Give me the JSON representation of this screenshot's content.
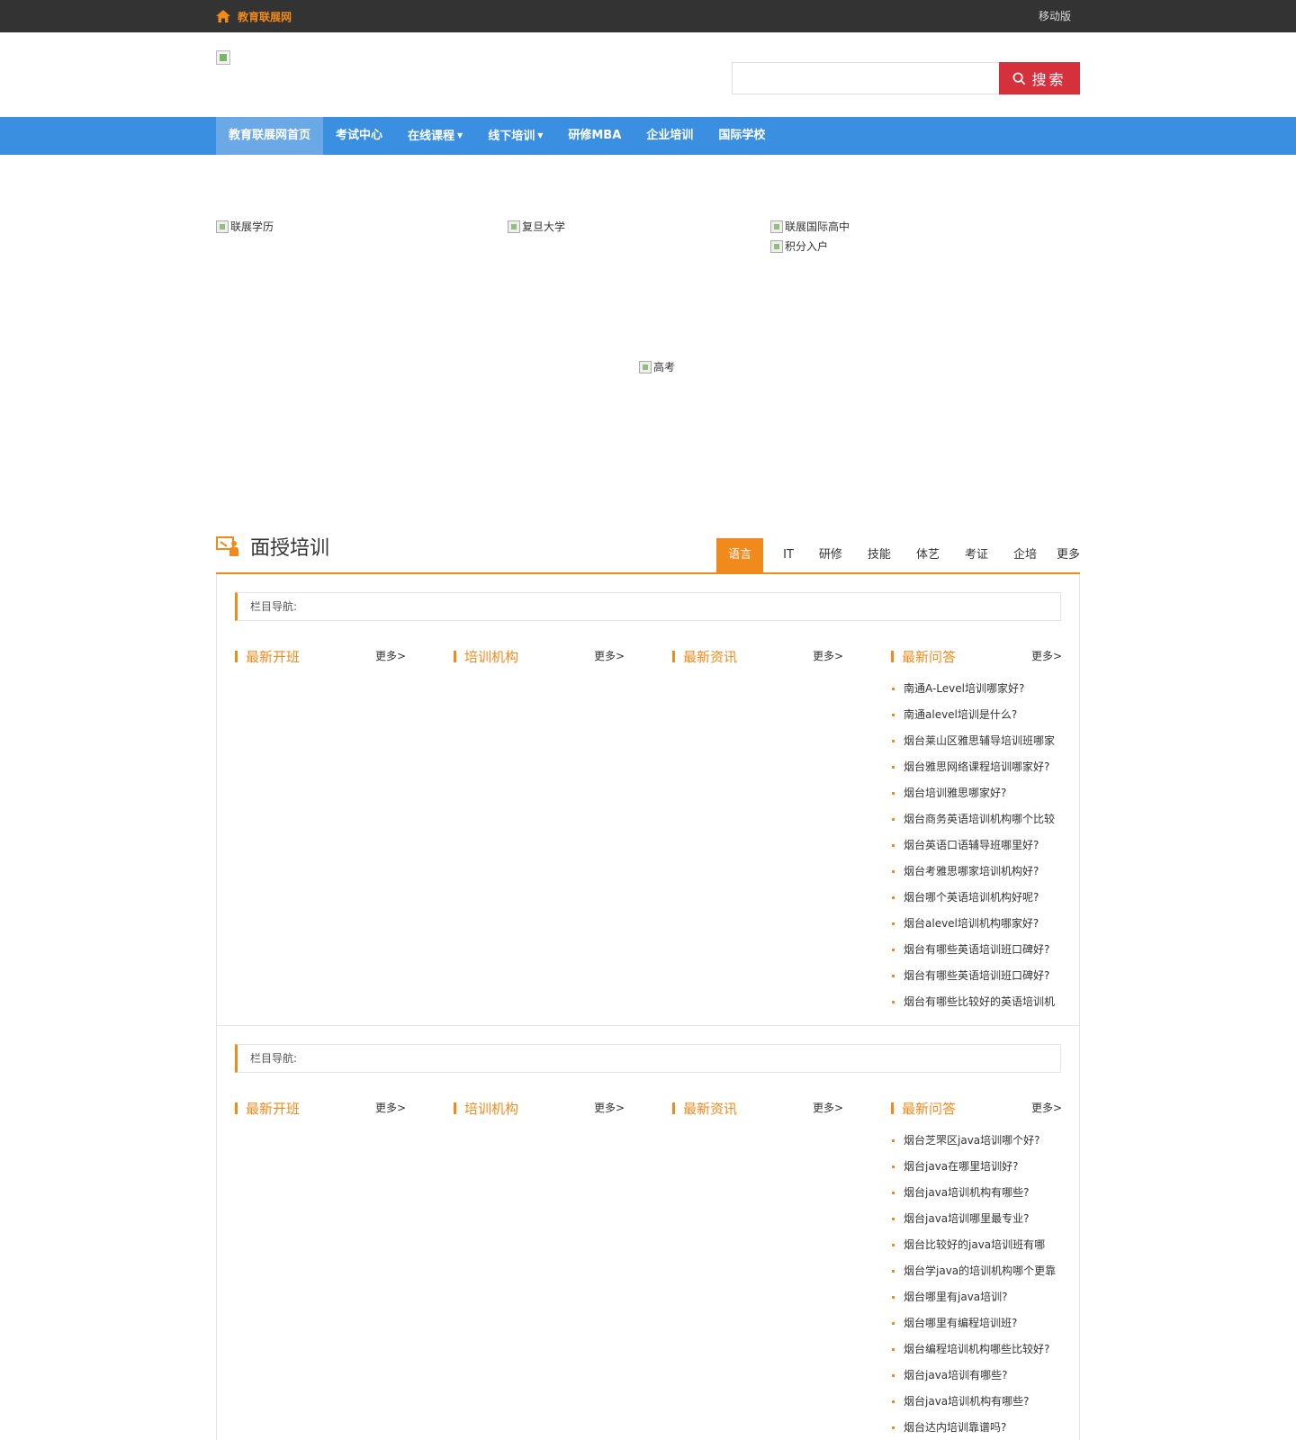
{
  "topbar": {
    "site_name": "教育联展网",
    "mobile_label": "移动版"
  },
  "search": {
    "placeholder": "",
    "button_label": "搜索"
  },
  "nav": {
    "items": [
      {
        "label": "教育联展网首页"
      },
      {
        "label": "考试中心"
      },
      {
        "label": "在线课程"
      },
      {
        "label": "线下培训"
      },
      {
        "label": "研修MBA"
      },
      {
        "label": "企业培训"
      },
      {
        "label": "国际学校"
      }
    ]
  },
  "banners": {
    "lianzhan_xueli": "联展学历",
    "fudan": "复旦大学",
    "guoji_gaozhong": "联展国际高中",
    "jifen_ruhu": "积分入户",
    "gaokao": "高考"
  },
  "section": {
    "title": "面授培训",
    "tabs": [
      "语言",
      "IT",
      "研修",
      "技能",
      "体艺",
      "考证",
      "企培"
    ],
    "more_label": "更多"
  },
  "blocks": [
    {
      "crumb_label": "栏目导航:",
      "columns": [
        {
          "title": "最新开班",
          "more": "更多>"
        },
        {
          "title": "培训机构",
          "more": "更多>"
        },
        {
          "title": "最新资讯",
          "more": "更多>"
        },
        {
          "title": "最新问答",
          "more": "更多>"
        }
      ],
      "qa": [
        "南通A-Level培训哪家好?",
        "南通alevel培训是什么?",
        "烟台莱山区雅思辅导培训班哪家",
        "烟台雅思网络课程培训哪家好?",
        "烟台培训雅思哪家好?",
        "烟台商务英语培训机构哪个比较",
        "烟台英语口语辅导班哪里好?",
        "烟台考雅思哪家培训机构好?",
        "烟台哪个英语培训机构好呢?",
        "烟台alevel培训机构哪家好?",
        "烟台有哪些英语培训班口碑好?",
        "烟台有哪些英语培训班口碑好?",
        "烟台有哪些比较好的英语培训机"
      ]
    },
    {
      "crumb_label": "栏目导航:",
      "columns": [
        {
          "title": "最新开班",
          "more": "更多>"
        },
        {
          "title": "培训机构",
          "more": "更多>"
        },
        {
          "title": "最新资讯",
          "more": "更多>"
        },
        {
          "title": "最新问答",
          "more": "更多>"
        }
      ],
      "qa": [
        "烟台芝罘区java培训哪个好?",
        "烟台java在哪里培训好?",
        "烟台java培训机构有哪些?",
        "烟台java培训哪里最专业?",
        "烟台比较好的java培训班有哪",
        "烟台学java的培训机构哪个更靠",
        "烟台哪里有java培训?",
        "烟台哪里有编程培训班?",
        "烟台编程培训机构哪些比较好?",
        "烟台java培训有哪些?",
        "烟台java培训机构有哪些?",
        "烟台达内培训靠谱吗?"
      ]
    }
  ],
  "colors": {
    "accent": "#f08a1c",
    "nav_bg": "#3b8fe0",
    "search_btn": "#d6303c",
    "topbar_bg": "#333333"
  },
  "icons": {
    "home": "home-icon",
    "search": "search-icon",
    "section": "teacher-board-icon"
  }
}
